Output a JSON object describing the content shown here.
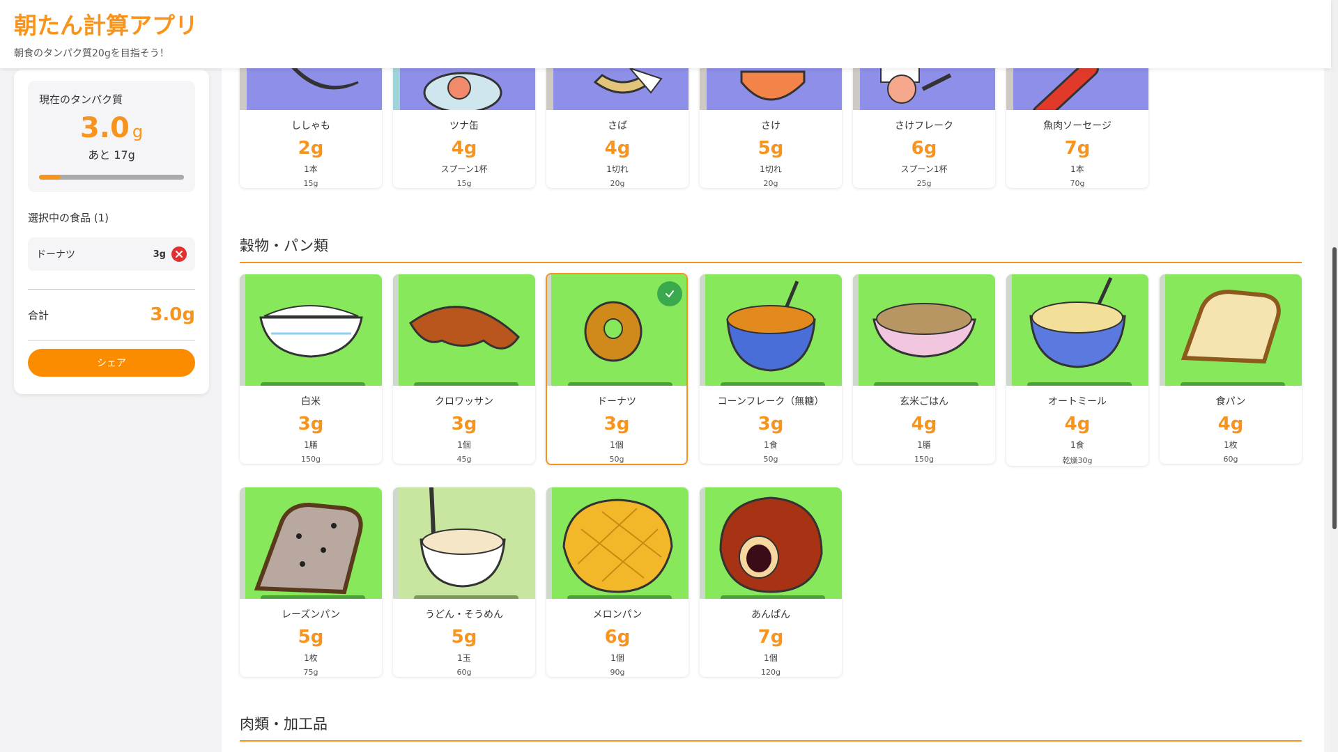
{
  "header": {
    "title": "朝たん計算アプリ",
    "subtitle": "朝食のタンパク質20gを目指そう！"
  },
  "sidebar": {
    "current_label": "現在のタンパク質",
    "current_value": "3.0",
    "current_unit": "g",
    "remaining": "あと 17g",
    "progress_fraction": 0.15,
    "selected_heading": "選択中の食品 (1)",
    "selected_items": [
      {
        "name": "ドーナツ",
        "protein": "3g"
      }
    ],
    "total_label": "合計",
    "total_value": "3.0g",
    "share_label": "シェア"
  },
  "sections": {
    "fish": {
      "items": [
        {
          "name": "ししゃも",
          "protein": "2g",
          "unit": "1本",
          "weight": "15g"
        },
        {
          "name": "ツナ缶",
          "protein": "4g",
          "unit": "スプーン1杯",
          "weight": "15g"
        },
        {
          "name": "さば",
          "protein": "4g",
          "unit": "1切れ",
          "weight": "20g"
        },
        {
          "name": "さけ",
          "protein": "5g",
          "unit": "1切れ",
          "weight": "20g"
        },
        {
          "name": "さけフレーク",
          "protein": "6g",
          "unit": "スプーン1杯",
          "weight": "25g"
        },
        {
          "name": "魚肉ソーセージ",
          "protein": "7g",
          "unit": "1本",
          "weight": "70g"
        }
      ]
    },
    "grains": {
      "title": "穀物・パン類",
      "items": [
        {
          "name": "白米",
          "protein": "3g",
          "unit": "1膳",
          "weight": "150g"
        },
        {
          "name": "クロワッサン",
          "protein": "3g",
          "unit": "1個",
          "weight": "45g"
        },
        {
          "name": "ドーナツ",
          "protein": "3g",
          "unit": "1個",
          "weight": "50g"
        },
        {
          "name": "コーンフレーク（無糖）",
          "protein": "3g",
          "unit": "1食",
          "weight": "50g"
        },
        {
          "name": "玄米ごはん",
          "protein": "4g",
          "unit": "1膳",
          "weight": "150g"
        },
        {
          "name": "オートミール",
          "protein": "4g",
          "unit": "1食",
          "weight": "乾燥30g"
        },
        {
          "name": "食パン",
          "protein": "4g",
          "unit": "1枚",
          "weight": "60g"
        },
        {
          "name": "レーズンパン",
          "protein": "5g",
          "unit": "1枚",
          "weight": "75g"
        },
        {
          "name": "うどん・そうめん",
          "protein": "5g",
          "unit": "1玉",
          "weight": "60g"
        },
        {
          "name": "メロンパン",
          "protein": "6g",
          "unit": "1個",
          "weight": "90g"
        },
        {
          "name": "あんぱん",
          "protein": "7g",
          "unit": "1個",
          "weight": "120g"
        }
      ]
    },
    "meat": {
      "title": "肉類・加工品"
    }
  },
  "icons": {
    "remove": "close-circle-icon",
    "selected": "check-circle-icon"
  },
  "colors": {
    "accent": "#f7941d",
    "share_button": "#fb8c00",
    "remove": "#e03030",
    "check": "#3aa84c",
    "fish_bg": "#8e8fe8",
    "grain_bg": "#86e85a"
  }
}
